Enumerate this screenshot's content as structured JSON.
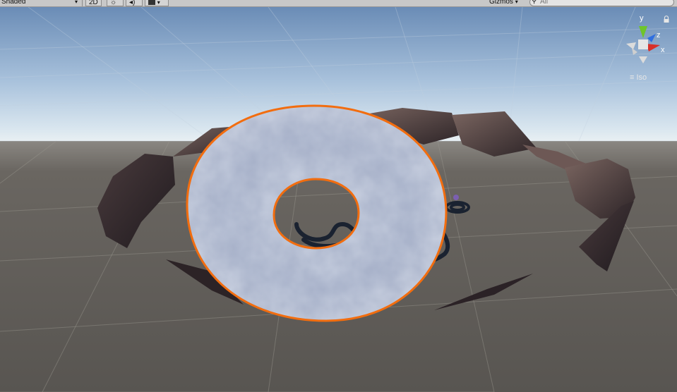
{
  "toolbar": {
    "shading_mode": "Shaded",
    "mode_2d": "2D",
    "gizmos_label": "Gizmos",
    "search_placeholder": "All"
  },
  "gizmo": {
    "y_label": "y",
    "z_label": "z",
    "x_label": "x",
    "projection_label": "Iso"
  },
  "colors": {
    "selection_outline": "#f26d0f",
    "sky_top": "#6f8fb8",
    "ground": "#5d5a56",
    "axis_x": "#d8302a",
    "axis_y": "#6fc52a",
    "axis_z": "#2f6fe0"
  }
}
